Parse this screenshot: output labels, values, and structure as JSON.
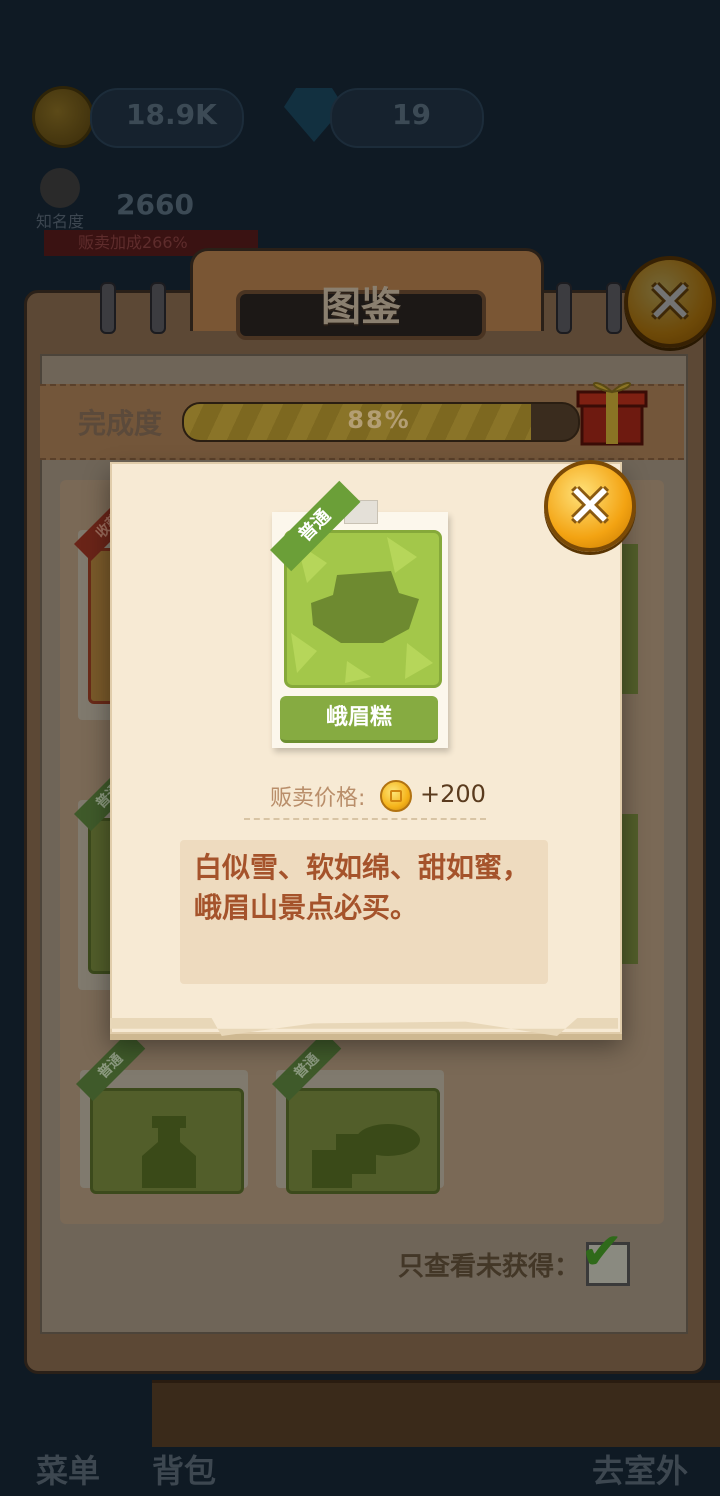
{
  "hud": {
    "coins": "18.9K",
    "gems": "19",
    "fame_label": "知名度",
    "fame_value": "2660",
    "sell_bonus": "贩卖加成266%"
  },
  "collection": {
    "title": "图鉴",
    "progress_label": "完成度",
    "progress_percent": 88,
    "progress_text": "88%",
    "tags": [
      "收藏",
      "普通",
      "普通",
      "普通"
    ],
    "filter_label": "只查看未获得：",
    "filter_checked": true
  },
  "detail": {
    "rarity": "普通",
    "name": "峨眉糕",
    "sell_price_label": "贩卖价格:",
    "sell_price_value": "+200",
    "description": "白似雪、软如绵、甜如蜜，峨眉山景点必买。"
  },
  "bottom_nav": {
    "menu": "菜单",
    "bag": "背包",
    "outdoor": "去室外"
  },
  "colors": {
    "accent_gold": "#f3a312",
    "common_green": "#6b9f38",
    "desc_text": "#a5532b"
  }
}
